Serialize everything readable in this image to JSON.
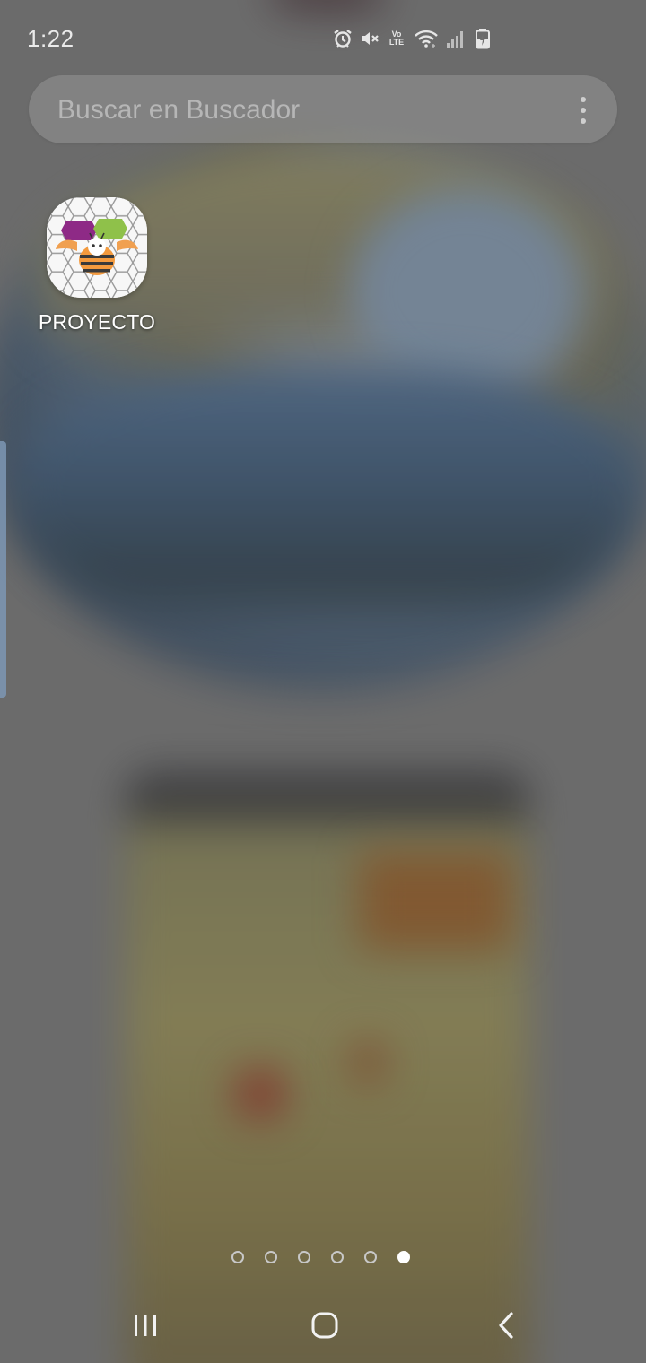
{
  "status_bar": {
    "time": "1:22",
    "icons": [
      "alarm-icon",
      "mute-icon",
      "volte-icon",
      "wifi-icon",
      "signal-icon",
      "battery-charging-icon"
    ],
    "volte_top": "Vo",
    "volte_bottom": "LTE"
  },
  "search": {
    "placeholder": "Buscar en Buscador",
    "menu_icon": "more-vert-icon"
  },
  "apps": [
    {
      "label": "PROYECTO",
      "icon": "proyecto-app-icon"
    }
  ],
  "pager": {
    "page_count": 6,
    "active_page": 6
  },
  "nav_bar": {
    "buttons": [
      "recent-apps",
      "home",
      "back"
    ]
  },
  "colors": {
    "edge_handle": "#7d96b4",
    "text_light": "#ffffff"
  }
}
